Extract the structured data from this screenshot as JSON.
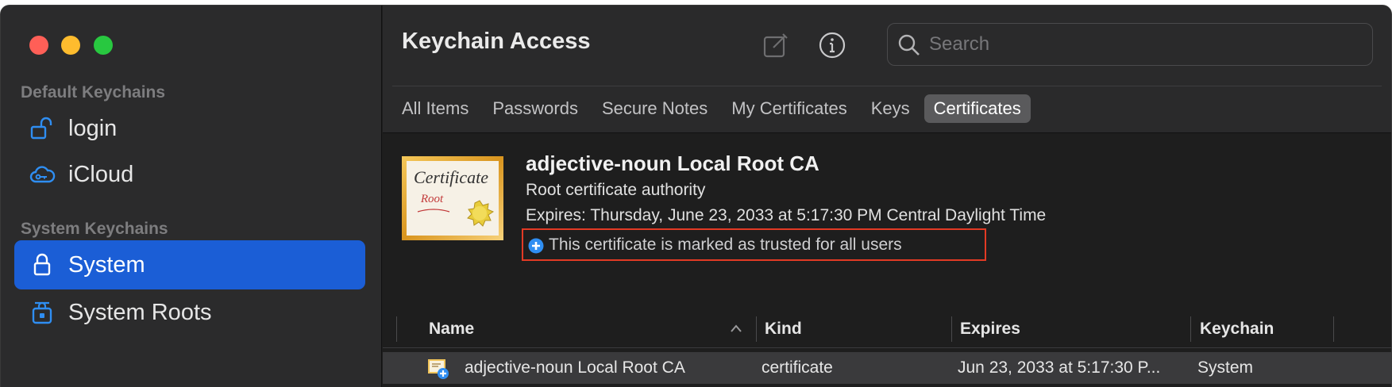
{
  "app": {
    "title": "Keychain Access"
  },
  "search": {
    "placeholder": "Search"
  },
  "sidebar": {
    "default_section": "Default Keychains",
    "system_section": "System Keychains",
    "items": [
      {
        "label": "login",
        "icon": "unlocked-padlock-icon"
      },
      {
        "label": "iCloud",
        "icon": "cloud-key-icon"
      },
      {
        "label": "System",
        "icon": "padlock-icon",
        "selected": true
      },
      {
        "label": "System Roots",
        "icon": "padlock-cabinet-icon"
      }
    ]
  },
  "tabs": [
    {
      "label": "All Items"
    },
    {
      "label": "Passwords"
    },
    {
      "label": "Secure Notes"
    },
    {
      "label": "My Certificates"
    },
    {
      "label": "Keys"
    },
    {
      "label": "Certificates",
      "selected": true
    }
  ],
  "certificate": {
    "thumb_title": "Certificate",
    "thumb_subtitle": "Root",
    "name": "adjective-noun Local Root CA",
    "type": "Root certificate authority",
    "expiry": "Expires: Thursday, June 23, 2033 at 5:17:30 PM Central Daylight Time",
    "trust": "This certificate is marked as trusted for all users"
  },
  "table": {
    "columns": [
      "Name",
      "Kind",
      "Expires",
      "Keychain"
    ],
    "rows": [
      {
        "name": "adjective-noun Local Root CA",
        "kind": "certificate",
        "expires": "Jun 23, 2033 at 5:17:30 P...",
        "keychain": "System"
      }
    ]
  },
  "colors": {
    "accent": "#1b5ed6",
    "highlight": "#e33a24",
    "trust_icon": "#2f8ef2"
  }
}
